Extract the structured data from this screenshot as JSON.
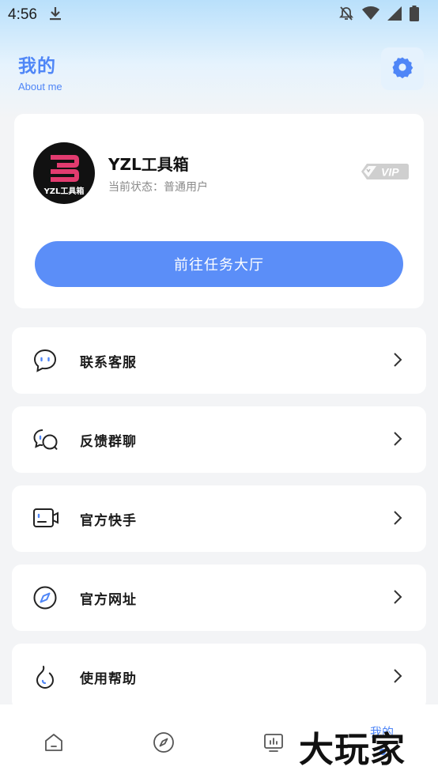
{
  "status_bar": {
    "time": "4:56"
  },
  "header": {
    "title": "我的",
    "subtitle": "About me"
  },
  "profile": {
    "avatar_text": "YZL工具箱",
    "name": "YZL工具箱",
    "status": "当前状态：普通用户",
    "badge": "VIP",
    "task_button": "前往任务大厅"
  },
  "menu": [
    {
      "label": "联系客服",
      "icon": "chat-bubble-icon"
    },
    {
      "label": "反馈群聊",
      "icon": "group-chat-icon"
    },
    {
      "label": "官方快手",
      "icon": "camera-icon"
    },
    {
      "label": "官方网址",
      "icon": "compass-icon"
    },
    {
      "label": "使用帮助",
      "icon": "flame-icon"
    }
  ],
  "bottom_nav": {
    "mine_label": "我的"
  },
  "watermark": "大玩家",
  "colors": {
    "accent": "#5b8ef8",
    "title_blue": "#4f86f7"
  }
}
